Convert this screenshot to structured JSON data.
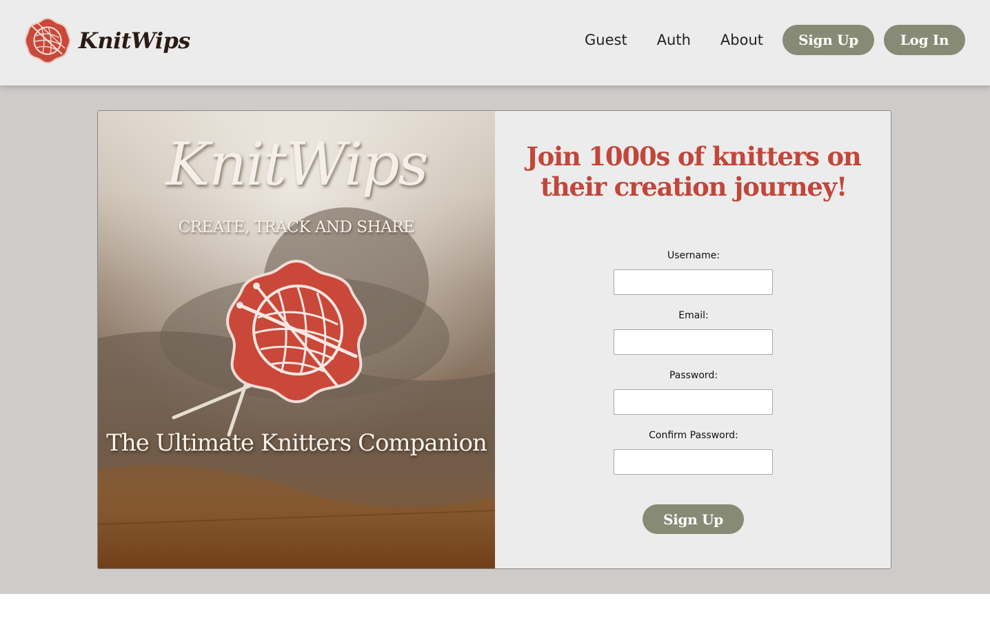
{
  "brand": {
    "name": "KnitWips",
    "logo_icon": "yarn-ball-logo-icon"
  },
  "nav": {
    "items": [
      {
        "label": "Guest"
      },
      {
        "label": "Auth"
      },
      {
        "label": "About"
      }
    ],
    "signup_label": "Sign Up",
    "login_label": "Log In"
  },
  "hero": {
    "title": "KnitWips",
    "tagline": "CREATE, TRACK AND SHARE",
    "emblem_icon": "yarn-ball-needles-emblem-icon",
    "subtitle": "The Ultimate Knitters Companion"
  },
  "form": {
    "heading": "Join 1000s of knitters on their creation journey!",
    "fields": [
      {
        "label": "Username:",
        "value": "",
        "placeholder": ""
      },
      {
        "label": "Email:",
        "value": "",
        "placeholder": ""
      },
      {
        "label": "Password:",
        "value": "",
        "placeholder": ""
      },
      {
        "label": "Confirm Password:",
        "value": "",
        "placeholder": ""
      }
    ],
    "submit_label": "Sign Up"
  },
  "colors": {
    "accent_red": "#c2463a",
    "button_olive": "#878a74",
    "header_bg": "#ececec",
    "page_bg": "#cfcbc8"
  }
}
